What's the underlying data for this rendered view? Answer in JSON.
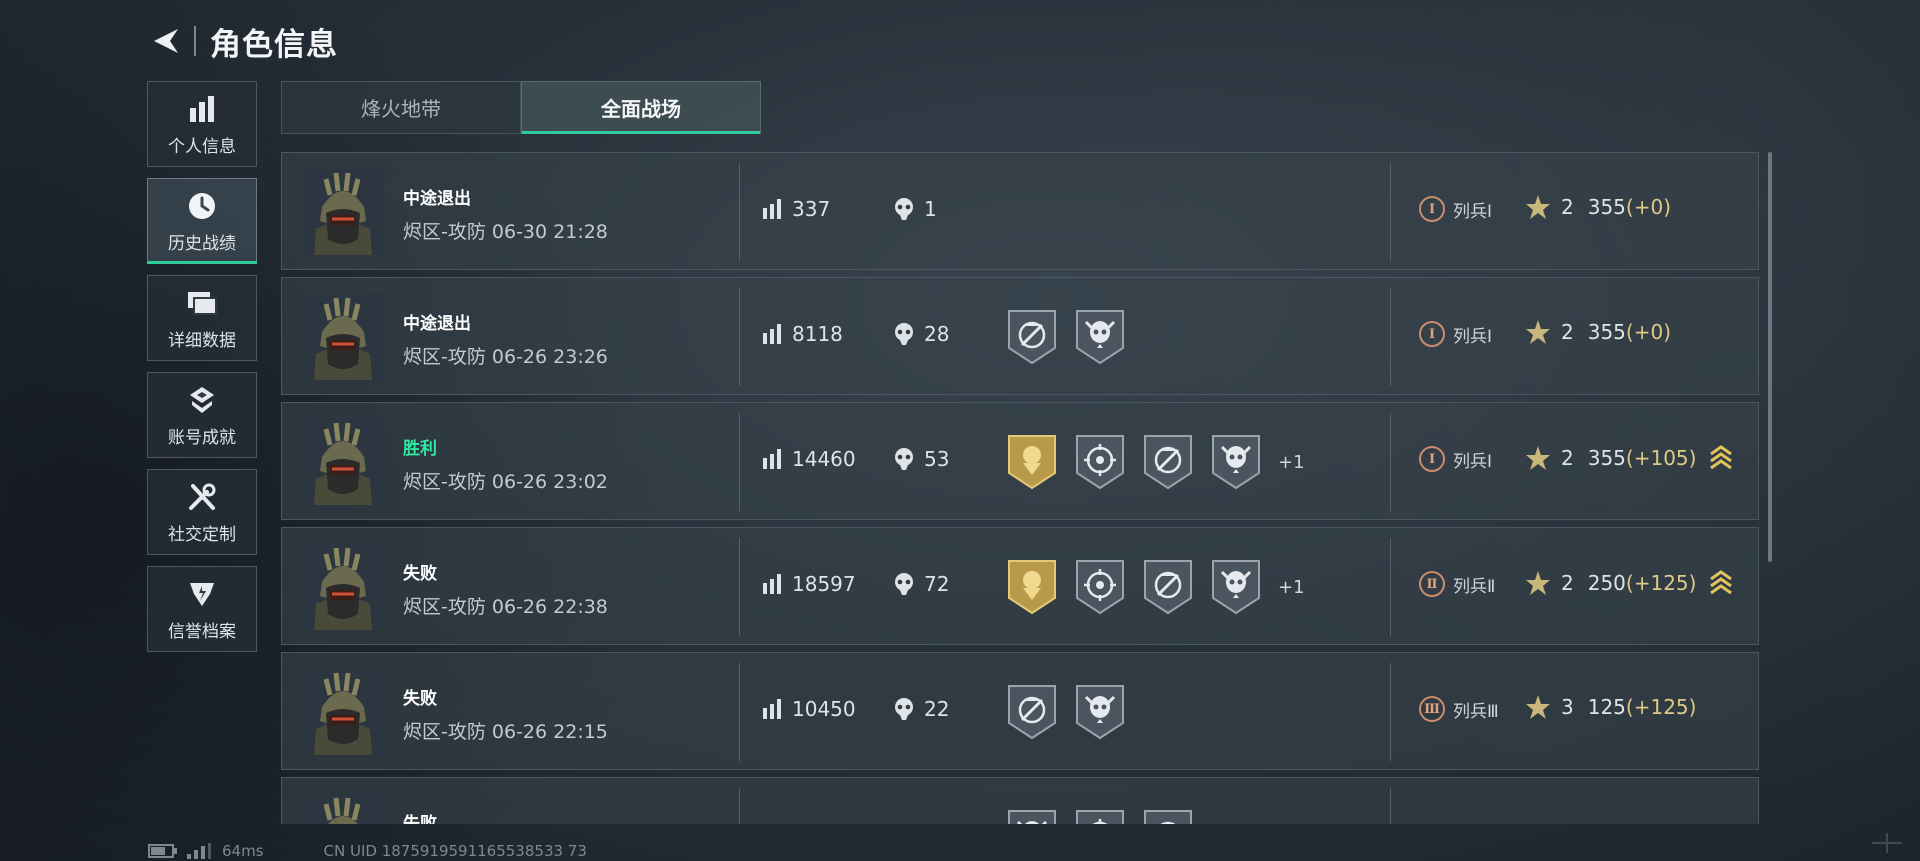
{
  "header": {
    "title": "角色信息"
  },
  "sidebar": {
    "items": [
      {
        "label": "个人信息",
        "icon": "bar-chart-icon"
      },
      {
        "label": "历史战绩",
        "icon": "clock-icon",
        "active": true
      },
      {
        "label": "详细数据",
        "icon": "cards-icon"
      },
      {
        "label": "账号成就",
        "icon": "achievement-icon"
      },
      {
        "label": "社交定制",
        "icon": "tools-icon"
      },
      {
        "label": "信誉档案",
        "icon": "shield-badge-icon"
      }
    ]
  },
  "tabs": [
    {
      "label": "烽火地带",
      "active": false
    },
    {
      "label": "全面战场",
      "active": true
    }
  ],
  "matches": [
    {
      "result": "中途退出",
      "map_time": "烬区-攻防 06-30 21:28",
      "score": "337",
      "kills": "1",
      "medals": [],
      "medal_more": "",
      "rank": "列兵Ⅰ",
      "rank_numeral": "Ⅰ",
      "level": "2",
      "points": "355",
      "delta": "(+0)",
      "promoted": false
    },
    {
      "result": "中途退出",
      "map_time": "烬区-攻防 06-26 23:26",
      "score": "8118",
      "kills": "28",
      "medals": [
        "scope",
        "skull"
      ],
      "medal_more": "",
      "rank": "列兵Ⅰ",
      "rank_numeral": "Ⅰ",
      "level": "2",
      "points": "355",
      "delta": "(+0)",
      "promoted": false
    },
    {
      "result": "胜利",
      "map_time": "烬区-攻防 06-26 23:02",
      "score": "14460",
      "kills": "53",
      "medals": [
        "gold",
        "target",
        "scope",
        "skull"
      ],
      "medal_more": "+1",
      "rank": "列兵Ⅰ",
      "rank_numeral": "Ⅰ",
      "level": "2",
      "points": "355",
      "delta": "(+105)",
      "promoted": true
    },
    {
      "result": "失败",
      "map_time": "烬区-攻防 06-26 22:38",
      "score": "18597",
      "kills": "72",
      "medals": [
        "gold",
        "target",
        "scope",
        "skull"
      ],
      "medal_more": "+1",
      "rank": "列兵Ⅱ",
      "rank_numeral": "Ⅱ",
      "level": "2",
      "points": "250",
      "delta": "(+125)",
      "promoted": true
    },
    {
      "result": "失败",
      "map_time": "烬区-攻防 06-26 22:15",
      "score": "10450",
      "kills": "22",
      "medals": [
        "scope",
        "skull"
      ],
      "medal_more": "",
      "rank": "列兵Ⅲ",
      "rank_numeral": "Ⅲ",
      "level": "3",
      "points": "125",
      "delta": "(+125)",
      "promoted": false
    },
    {
      "result": "失败",
      "map_time": "",
      "score": "",
      "kills": "",
      "medals": [
        "skull",
        "target",
        "scope"
      ],
      "medal_more": "",
      "rank": "",
      "rank_numeral": "",
      "level": "",
      "points": "",
      "delta": "",
      "promoted": false
    }
  ],
  "status": {
    "ping": "64ms",
    "uid": "CN UID 1875919591165538533 73"
  },
  "colors": {
    "accent": "#2ecc9a",
    "win": "#2ee8a3",
    "gold": "#e0c987",
    "rank": "#c98c6f"
  }
}
